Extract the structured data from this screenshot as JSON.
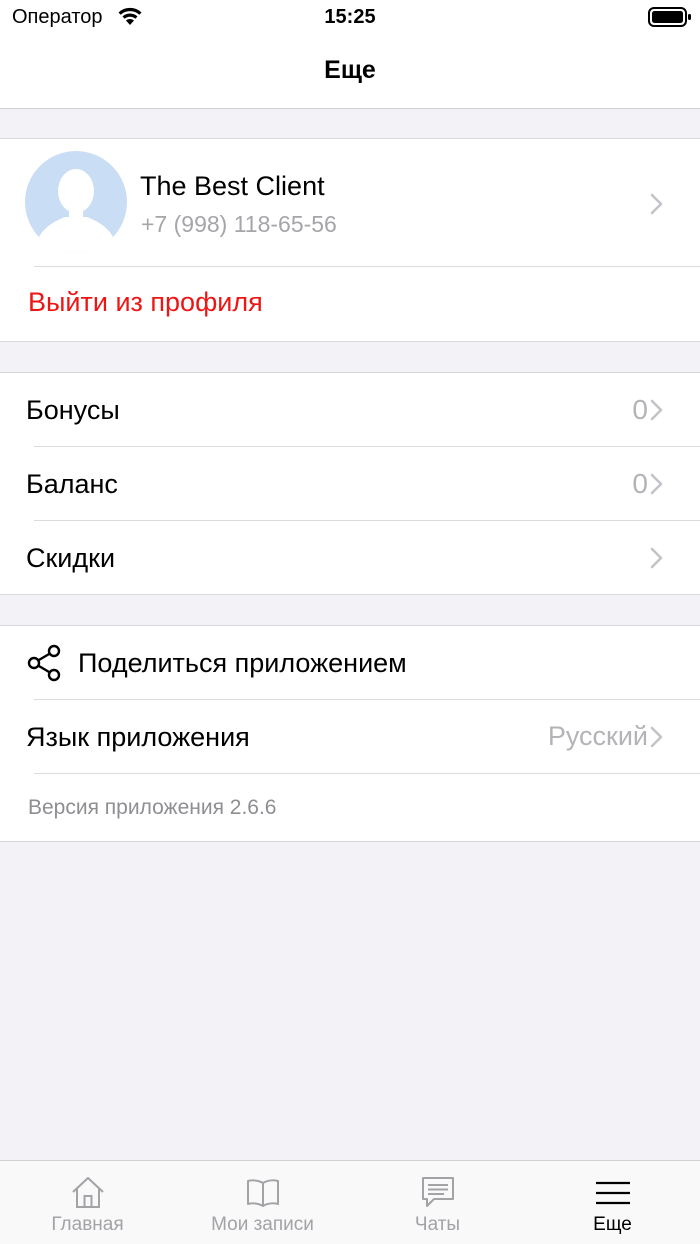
{
  "status_bar": {
    "carrier": "Оператор",
    "time": "15:25"
  },
  "nav": {
    "title": "Еще"
  },
  "profile": {
    "name": "The Best Client",
    "phone": "+7 (998) 118-65-56",
    "logout_label": "Выйти из профиля"
  },
  "account": {
    "items": [
      {
        "label": "Бонусы",
        "value": "0"
      },
      {
        "label": "Баланс",
        "value": "0"
      },
      {
        "label": "Скидки",
        "value": ""
      }
    ]
  },
  "app": {
    "share_label": "Поделиться приложением",
    "language_label": "Язык приложения",
    "language_value": "Русский",
    "version_text": "Версия приложения 2.6.6"
  },
  "tabbar": {
    "tabs": [
      {
        "label": "Главная",
        "icon": "home-icon",
        "active": false
      },
      {
        "label": "Мои записи",
        "icon": "book-icon",
        "active": false
      },
      {
        "label": "Чаты",
        "icon": "chat-icon",
        "active": false
      },
      {
        "label": "Еще",
        "icon": "menu-icon",
        "active": true
      }
    ]
  },
  "colors": {
    "background": "#f2f2f7",
    "destructive": "#ee1515",
    "secondary_text": "#a5a5aa",
    "avatar_bg": "#c9def5"
  }
}
